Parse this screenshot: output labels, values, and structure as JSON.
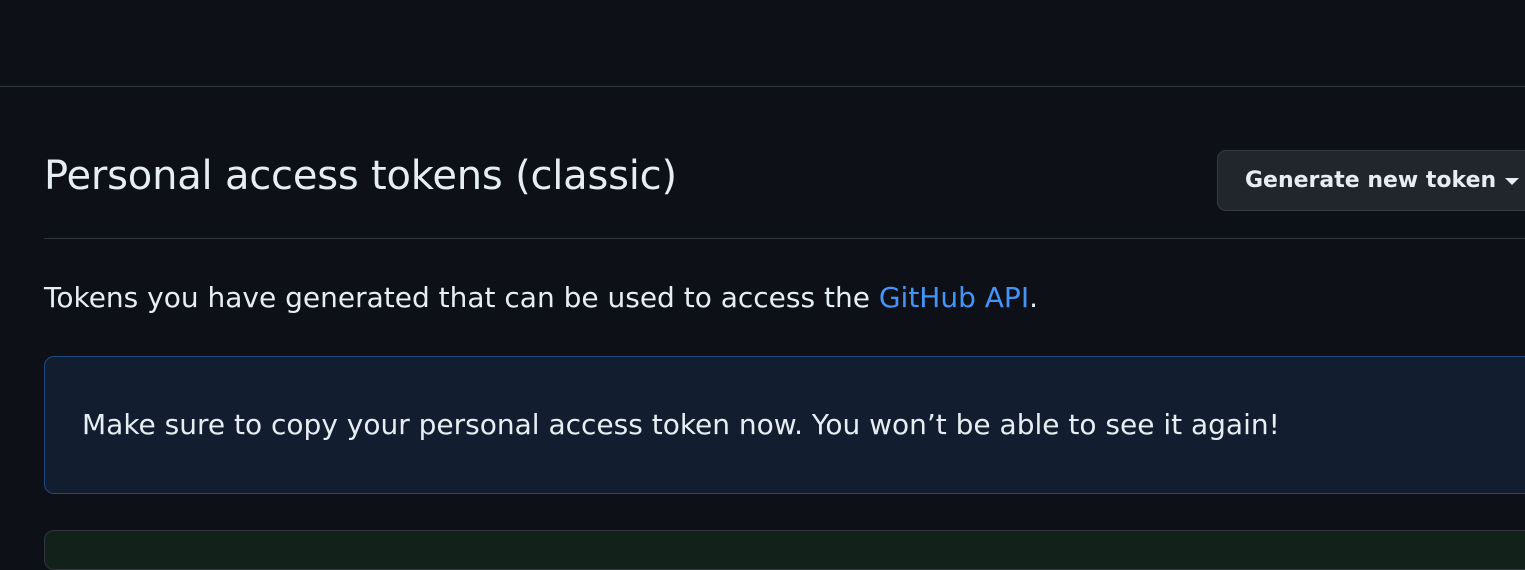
{
  "header": {
    "title": "Personal access tokens (classic)",
    "generate_button": {
      "label": "Generate new token",
      "icon": "caret-down-icon"
    }
  },
  "description": {
    "text_before_link": "Tokens you have generated that can be used to access the ",
    "link_text": "GitHub API",
    "text_after_link": "."
  },
  "flash_notice": {
    "message": "Make sure to copy your personal access token now. You won’t be able to see it again!"
  },
  "colors": {
    "background": "#0d1117",
    "text": "#e6edf3",
    "link": "#4493f8",
    "border": "#30363d",
    "flash_bg": "#121d2f",
    "flash_border": "#1f4a82",
    "button_bg": "#21262d"
  }
}
